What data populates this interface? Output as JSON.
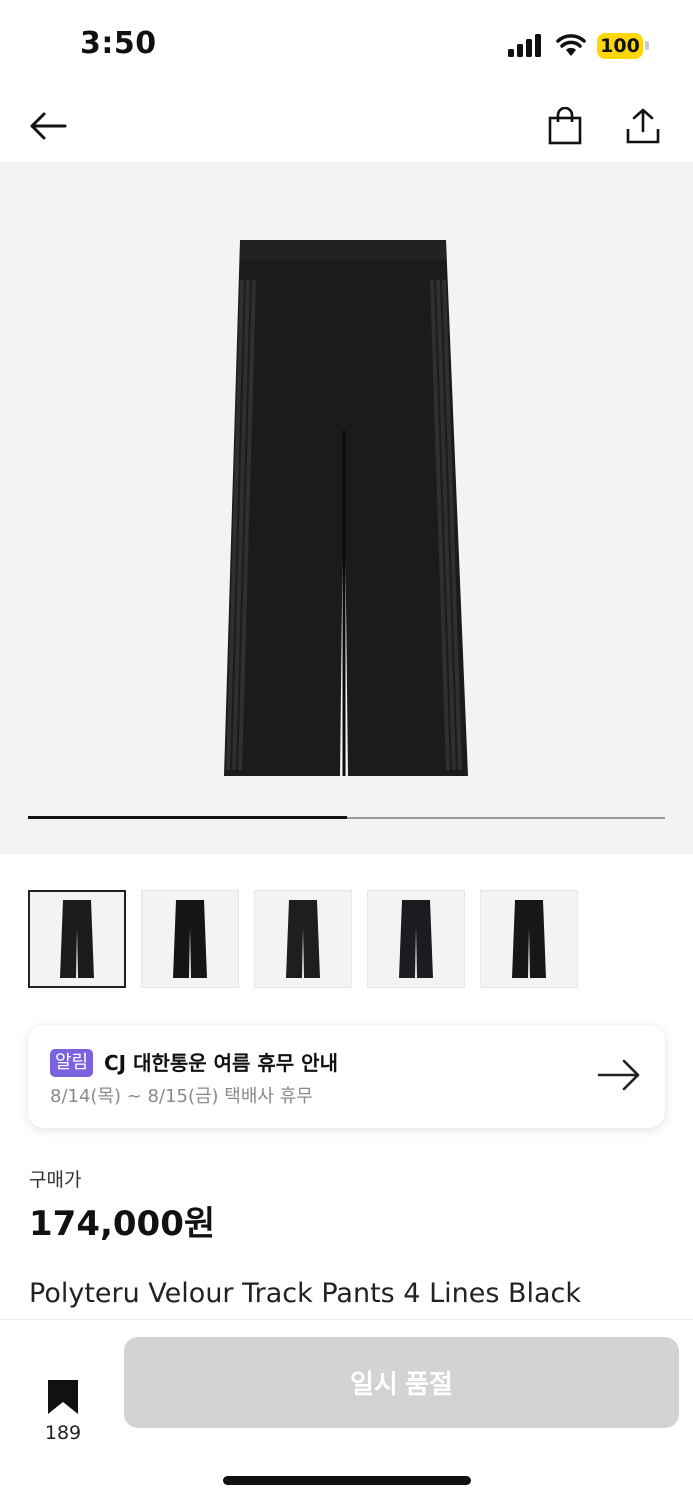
{
  "status_bar": {
    "time": "3:50",
    "battery": "100"
  },
  "nav": {
    "back_icon": "arrow-left-icon",
    "cart_icon": "shopping-bag-icon",
    "share_icon": "share-icon"
  },
  "gallery": {
    "image_count": 5,
    "current_index": 1,
    "progress": 0.5
  },
  "notice": {
    "badge": "알림",
    "title": "CJ 대한통운 여름 휴무 안내",
    "subtitle": "8/14(목) ~ 8/15(금) 택배사 휴무"
  },
  "price": {
    "label": "구매가",
    "value": "174,000원"
  },
  "product": {
    "name": "Polyteru Velour Track Pants 4 Lines Black"
  },
  "bottom_bar": {
    "bookmark_count": "189",
    "action_label": "일시 품절"
  },
  "colors": {
    "accent_badge": "#7b63e0",
    "battery": "#ffd60a",
    "disabled_button": "#d3d3d3"
  }
}
